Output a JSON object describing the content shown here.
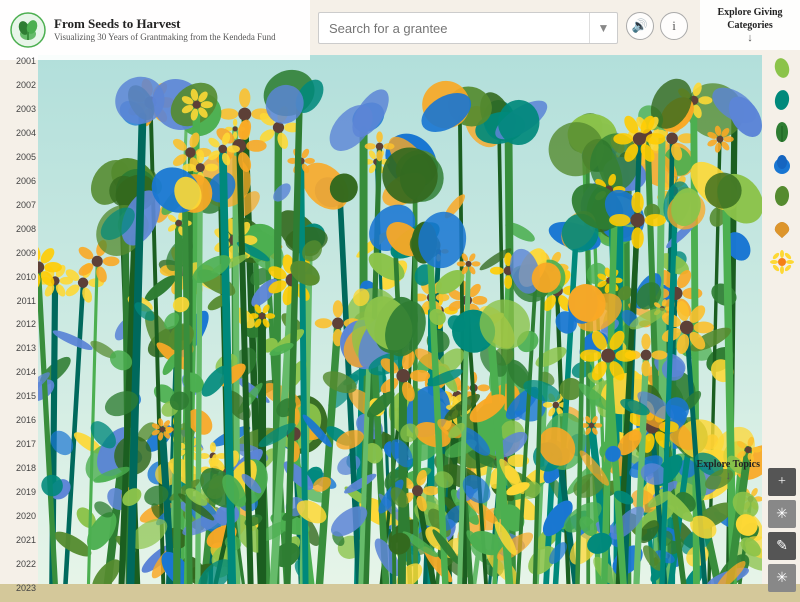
{
  "header": {
    "title": "From Seeds to Harvest",
    "subtitle": "Visualizing 30 Years of Grantmaking from the Kendeda Fund"
  },
  "search": {
    "placeholder": "Search for a grantee"
  },
  "explore_giving": {
    "label": "Explore Giving Categories",
    "arrow": "↓"
  },
  "explore_topics": {
    "label": "Explore Topics",
    "arrow": "↓"
  },
  "years": [
    "2001",
    "2002",
    "2003",
    "2004",
    "2005",
    "2006",
    "2007",
    "2008",
    "2009",
    "2010",
    "2011",
    "2012",
    "2013",
    "2014",
    "2015",
    "2016",
    "2017",
    "2018",
    "2019",
    "2020",
    "2021",
    "2022",
    "2023"
  ],
  "toolbar": {
    "zoom_in": "+",
    "snowflake": "✳",
    "pencil": "✎",
    "asterisk": "✳"
  },
  "category_icons": [
    {
      "name": "leaf-green-light",
      "color": "#8bc34a"
    },
    {
      "name": "leaf-teal",
      "color": "#00897b"
    },
    {
      "name": "leaf-dark-green",
      "color": "#2e7d32"
    },
    {
      "name": "leaf-blue",
      "color": "#1565c0"
    },
    {
      "name": "leaf-medium-green",
      "color": "#558b2f"
    },
    {
      "name": "leaf-golden",
      "color": "#f9a825"
    },
    {
      "name": "flower-yellow",
      "color": "#fdd835"
    }
  ],
  "colors": {
    "bg": "#f5f0e8",
    "stem_green": "#4caf50",
    "dark_teal": "#00695c",
    "medium_blue": "#5c85d6",
    "light_green": "#8bc34a",
    "dark_green": "#2e7d32",
    "yellow": "#fdd835",
    "bottom_strip": "#d4c89a"
  }
}
